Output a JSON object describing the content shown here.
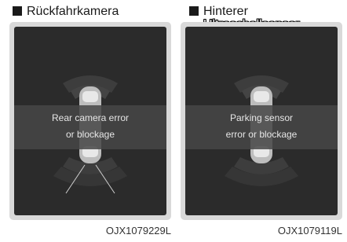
{
  "panels": [
    {
      "title_line1": "Rückfahrkamera",
      "title_line2": "",
      "message_line1": "Rear camera error",
      "message_line2": "or blockage",
      "code": "OJX1079229L"
    },
    {
      "title_line1": "Hinterer",
      "title_line2": "Ultraschallsensor",
      "message_line1": "Parking sensor",
      "message_line2": "error or blockage",
      "code": "OJX1079119L"
    }
  ]
}
